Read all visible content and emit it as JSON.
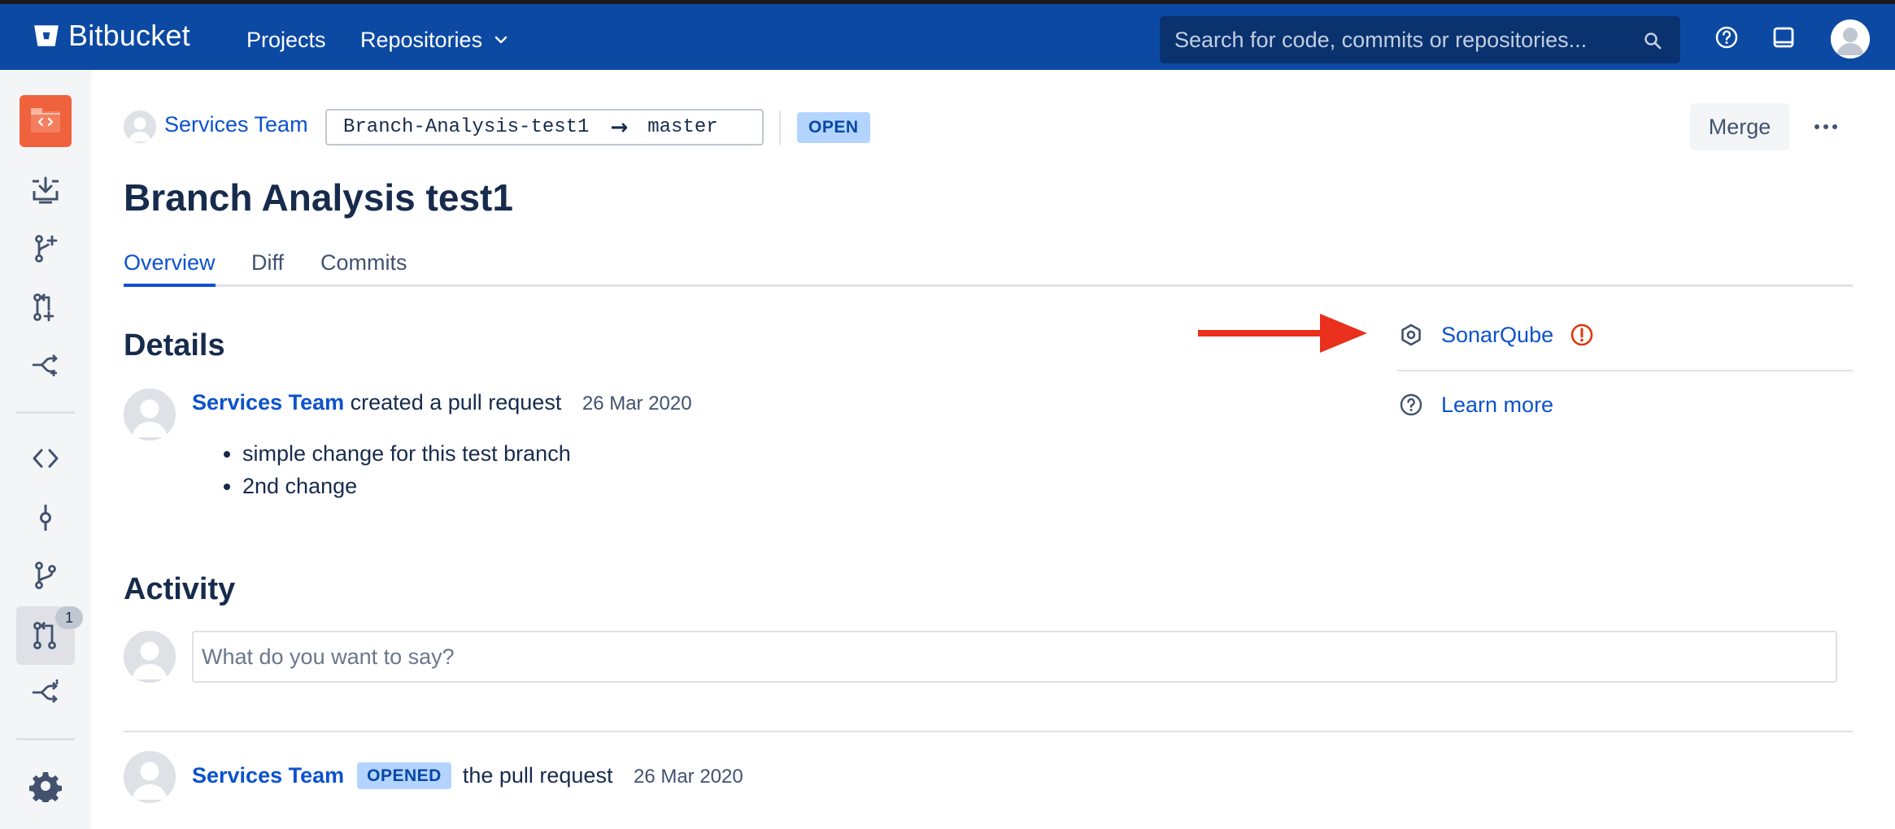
{
  "topbar": {
    "brand": "Bitbucket",
    "nav": {
      "projects": "Projects",
      "repositories": "Repositories"
    },
    "search": {
      "placeholder": "Search for code, commits or repositories..."
    },
    "icons": [
      "search-icon",
      "help-icon",
      "notification-icon",
      "user-avatar"
    ],
    "background_color": "#0c49a3"
  },
  "sidebar": {
    "repo_avatar_color": "#f0623d",
    "items": [
      {
        "name": "clone",
        "icon": "clone-icon"
      },
      {
        "name": "create-branch",
        "icon": "create-branch-icon"
      },
      {
        "name": "create-pull-request",
        "icon": "create-pull-request-icon"
      },
      {
        "name": "create-fork",
        "icon": "fork-icon"
      },
      {
        "name": "source",
        "icon": "code-icon"
      },
      {
        "name": "commits",
        "icon": "commit-icon"
      },
      {
        "name": "branches",
        "icon": "branches-icon"
      },
      {
        "name": "pull-requests",
        "icon": "pull-request-icon",
        "active": true,
        "badge": "1"
      },
      {
        "name": "forks",
        "icon": "forks-icon"
      },
      {
        "name": "settings",
        "icon": "gear-icon"
      }
    ]
  },
  "pull_request": {
    "owner": "Services Team",
    "source_branch": "Branch-Analysis-test1",
    "target_branch": "master",
    "status": "OPEN",
    "title": "Branch Analysis test1",
    "actions": {
      "merge": "Merge"
    }
  },
  "tabs": {
    "overview": "Overview",
    "diff": "Diff",
    "commits": "Commits",
    "active": "overview"
  },
  "details": {
    "heading": "Details",
    "author": "Services Team",
    "action_text": "created a pull request",
    "date": "26 Mar 2020",
    "description": [
      "simple change for this test branch",
      "2nd change"
    ]
  },
  "activity": {
    "heading": "Activity",
    "comment_placeholder": "What do you want to say?",
    "event": {
      "author": "Services Team",
      "badge": "OPENED",
      "text": "the pull request",
      "date": "26 Mar 2020"
    }
  },
  "right_panel": {
    "sonarqube": {
      "label": "SonarQube",
      "icon": "hexagon-icon",
      "status_icon": "warning-icon",
      "status_color": "#de350b"
    },
    "learn_more": {
      "label": "Learn more",
      "icon": "help-icon"
    },
    "annotation_arrow_color": "#e8301c"
  }
}
